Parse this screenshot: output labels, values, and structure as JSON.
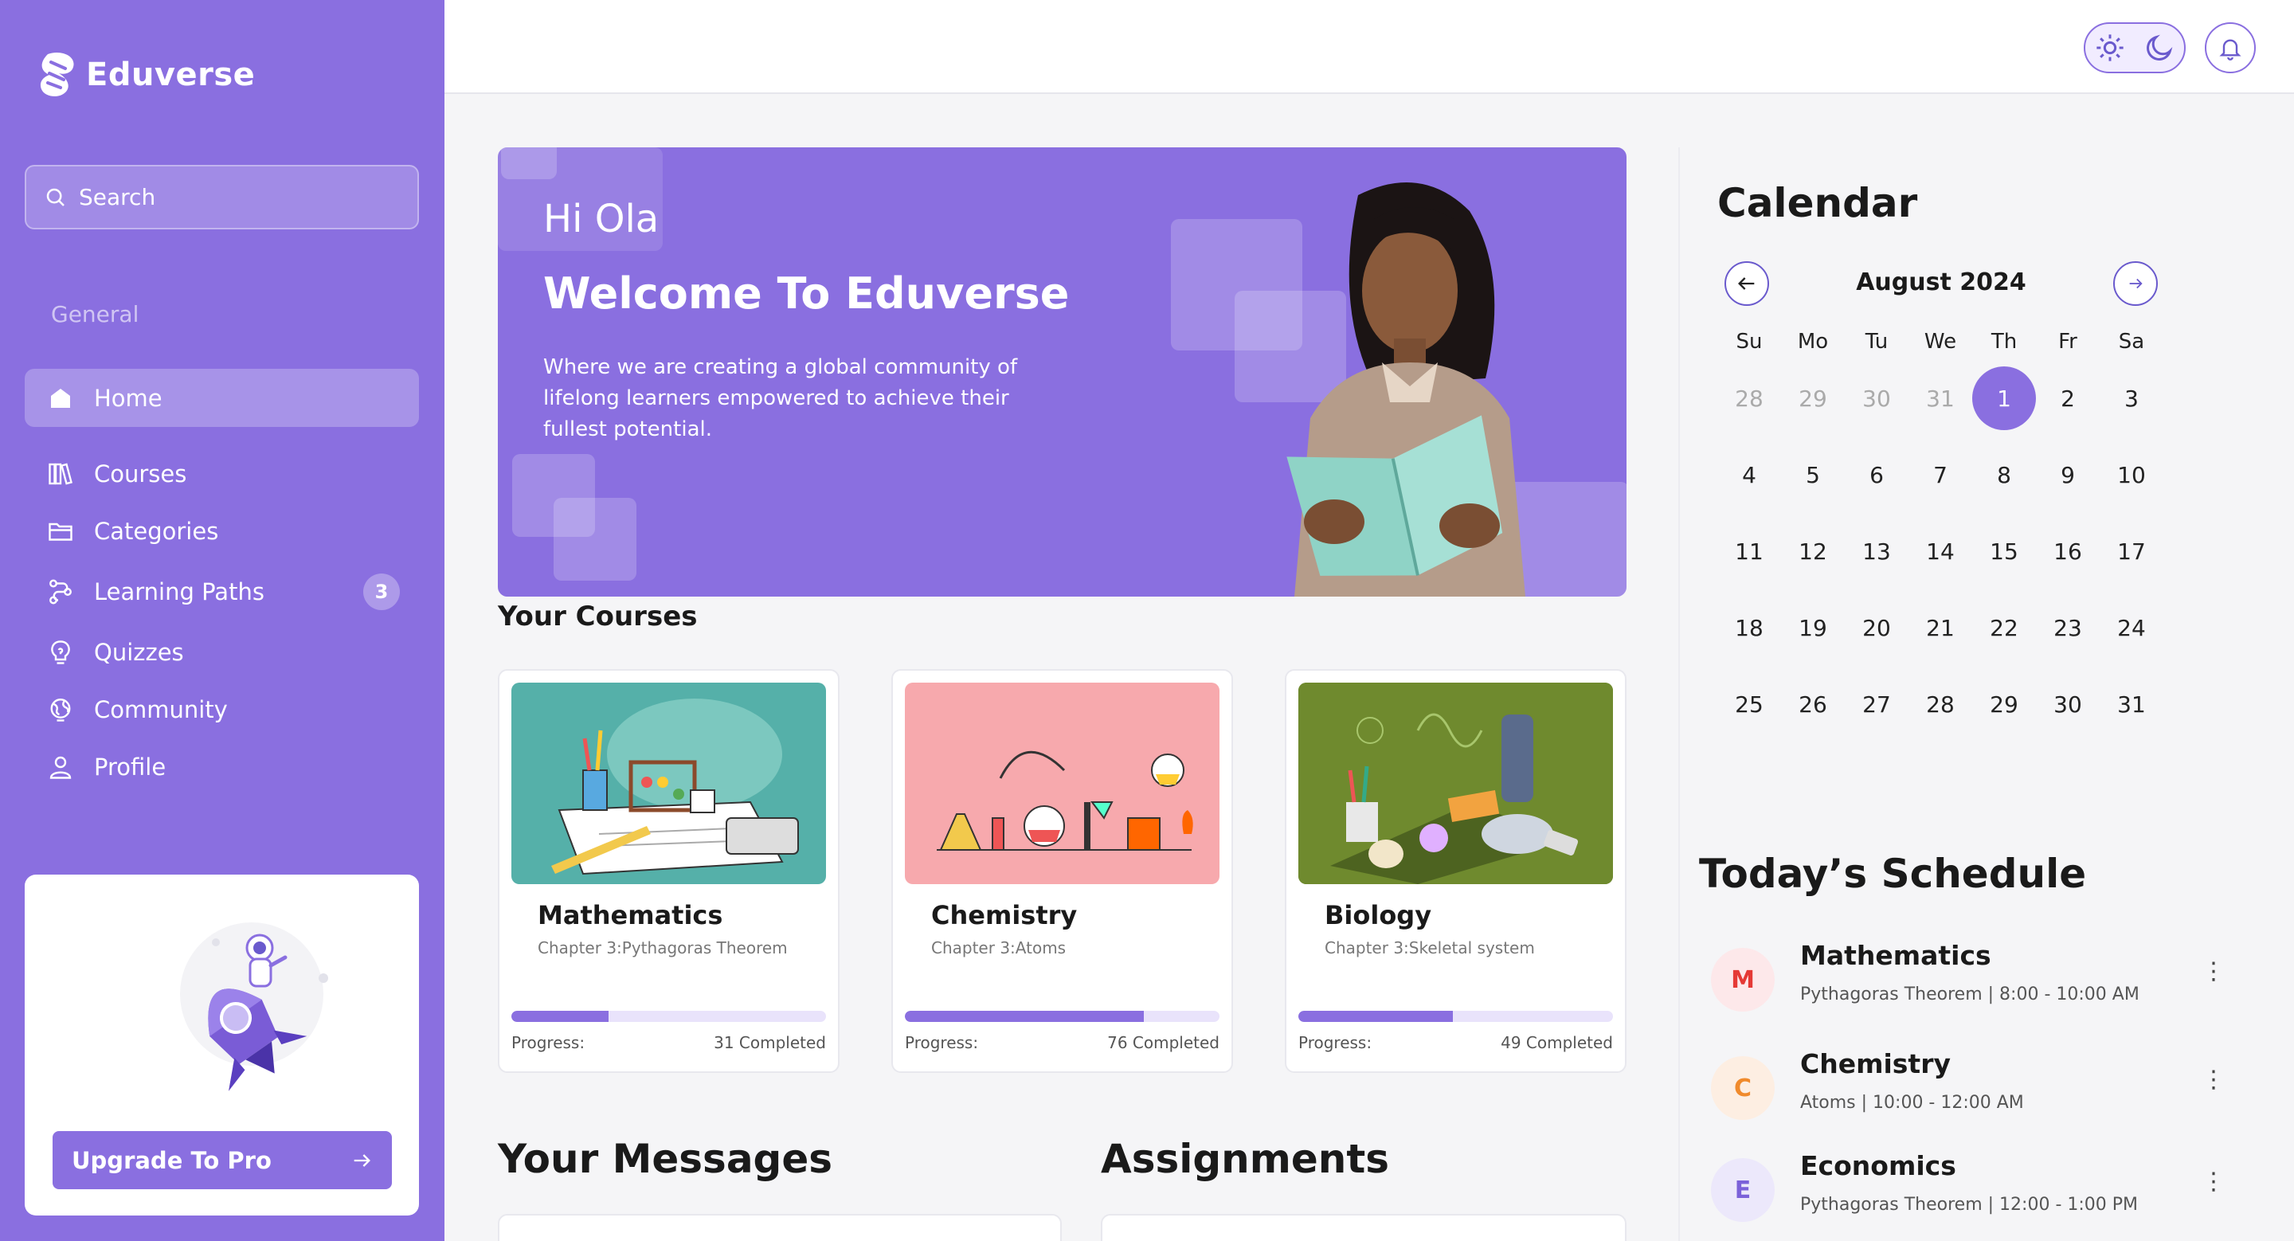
{
  "app": {
    "name": "Eduverse"
  },
  "search": {
    "placeholder": "Search"
  },
  "sidebar": {
    "section_label": "General",
    "items": [
      {
        "label": "Home",
        "icon": "home-icon"
      },
      {
        "label": "Courses",
        "icon": "books-icon"
      },
      {
        "label": "Categories",
        "icon": "folder-icon"
      },
      {
        "label": "Learning Paths",
        "icon": "route-icon",
        "badge": "3"
      },
      {
        "label": "Quizzes",
        "icon": "lightbulb-icon"
      },
      {
        "label": "Community",
        "icon": "globe-icon"
      },
      {
        "label": "Profile",
        "icon": "user-icon"
      }
    ],
    "upgrade_label": "Upgrade To Pro"
  },
  "hero": {
    "greeting": "Hi Ola",
    "title": "Welcome To Eduverse",
    "subtitle": "Where we are creating a global community of lifelong learners empowered to achieve their fullest potential."
  },
  "courses": {
    "heading": "Your Courses",
    "progress_label": "Progress:",
    "items": [
      {
        "title": "Mathematics",
        "chapter": "Chapter 3:Pythagoras Theorem",
        "completed": "31 Completed",
        "progress": 0.31,
        "image_bg": "#55b0a9"
      },
      {
        "title": "Chemistry",
        "chapter": "Chapter 3:Atoms",
        "completed": "76 Completed",
        "progress": 0.76,
        "image_bg": "#f7a9ad"
      },
      {
        "title": "Biology",
        "chapter": "Chapter 3:Skeletal system",
        "completed": "49 Completed",
        "progress": 0.49,
        "image_bg": "#6f8a2e"
      }
    ]
  },
  "messages": {
    "heading": "Your Messages"
  },
  "assignments": {
    "heading": "Assignments"
  },
  "calendar": {
    "title": "Calendar",
    "month": "August 2024",
    "weekdays": [
      "Su",
      "Mo",
      "Tu",
      "We",
      "Th",
      "Fr",
      "Sa"
    ],
    "weeks": [
      [
        "28",
        "29",
        "30",
        "31",
        "1",
        "2",
        "3"
      ],
      [
        "4",
        "5",
        "6",
        "7",
        "8",
        "9",
        "10"
      ],
      [
        "11",
        "12",
        "13",
        "14",
        "15",
        "16",
        "17"
      ],
      [
        "18",
        "19",
        "20",
        "21",
        "22",
        "23",
        "24"
      ],
      [
        "25",
        "26",
        "27",
        "28",
        "29",
        "30",
        "31"
      ]
    ],
    "selected_day": "1"
  },
  "schedule": {
    "title": "Today’s Schedule",
    "items": [
      {
        "initial": "M",
        "name": "Mathematics",
        "detail": "Pythagoras Theorem | 8:00 - 10:00 AM",
        "color": "#e53935",
        "bg": "#fde8ea"
      },
      {
        "initial": "C",
        "name": "Chemistry",
        "detail": "Atoms | 10:00 - 12:00 AM",
        "color": "#f08a2c",
        "bg": "#fdeee2"
      },
      {
        "initial": "E",
        "name": "Economics",
        "detail": "Pythagoras Theorem | 12:00 - 1:00 PM",
        "color": "#7b61d9",
        "bg": "#ece8fb"
      }
    ]
  },
  "colors": {
    "accent": "#8a6fe0",
    "background": "#f5f5f7"
  }
}
